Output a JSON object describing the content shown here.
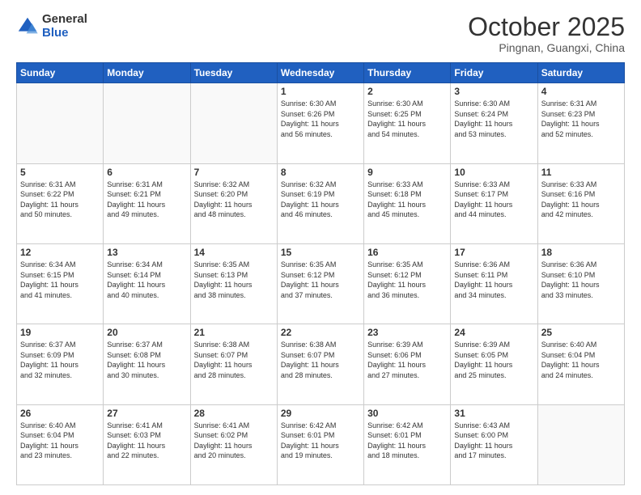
{
  "logo": {
    "general": "General",
    "blue": "Blue"
  },
  "header": {
    "month": "October 2025",
    "location": "Pingnan, Guangxi, China"
  },
  "weekdays": [
    "Sunday",
    "Monday",
    "Tuesday",
    "Wednesday",
    "Thursday",
    "Friday",
    "Saturday"
  ],
  "weeks": [
    [
      {
        "day": "",
        "info": ""
      },
      {
        "day": "",
        "info": ""
      },
      {
        "day": "",
        "info": ""
      },
      {
        "day": "1",
        "info": "Sunrise: 6:30 AM\nSunset: 6:26 PM\nDaylight: 11 hours\nand 56 minutes."
      },
      {
        "day": "2",
        "info": "Sunrise: 6:30 AM\nSunset: 6:25 PM\nDaylight: 11 hours\nand 54 minutes."
      },
      {
        "day": "3",
        "info": "Sunrise: 6:30 AM\nSunset: 6:24 PM\nDaylight: 11 hours\nand 53 minutes."
      },
      {
        "day": "4",
        "info": "Sunrise: 6:31 AM\nSunset: 6:23 PM\nDaylight: 11 hours\nand 52 minutes."
      }
    ],
    [
      {
        "day": "5",
        "info": "Sunrise: 6:31 AM\nSunset: 6:22 PM\nDaylight: 11 hours\nand 50 minutes."
      },
      {
        "day": "6",
        "info": "Sunrise: 6:31 AM\nSunset: 6:21 PM\nDaylight: 11 hours\nand 49 minutes."
      },
      {
        "day": "7",
        "info": "Sunrise: 6:32 AM\nSunset: 6:20 PM\nDaylight: 11 hours\nand 48 minutes."
      },
      {
        "day": "8",
        "info": "Sunrise: 6:32 AM\nSunset: 6:19 PM\nDaylight: 11 hours\nand 46 minutes."
      },
      {
        "day": "9",
        "info": "Sunrise: 6:33 AM\nSunset: 6:18 PM\nDaylight: 11 hours\nand 45 minutes."
      },
      {
        "day": "10",
        "info": "Sunrise: 6:33 AM\nSunset: 6:17 PM\nDaylight: 11 hours\nand 44 minutes."
      },
      {
        "day": "11",
        "info": "Sunrise: 6:33 AM\nSunset: 6:16 PM\nDaylight: 11 hours\nand 42 minutes."
      }
    ],
    [
      {
        "day": "12",
        "info": "Sunrise: 6:34 AM\nSunset: 6:15 PM\nDaylight: 11 hours\nand 41 minutes."
      },
      {
        "day": "13",
        "info": "Sunrise: 6:34 AM\nSunset: 6:14 PM\nDaylight: 11 hours\nand 40 minutes."
      },
      {
        "day": "14",
        "info": "Sunrise: 6:35 AM\nSunset: 6:13 PM\nDaylight: 11 hours\nand 38 minutes."
      },
      {
        "day": "15",
        "info": "Sunrise: 6:35 AM\nSunset: 6:12 PM\nDaylight: 11 hours\nand 37 minutes."
      },
      {
        "day": "16",
        "info": "Sunrise: 6:35 AM\nSunset: 6:12 PM\nDaylight: 11 hours\nand 36 minutes."
      },
      {
        "day": "17",
        "info": "Sunrise: 6:36 AM\nSunset: 6:11 PM\nDaylight: 11 hours\nand 34 minutes."
      },
      {
        "day": "18",
        "info": "Sunrise: 6:36 AM\nSunset: 6:10 PM\nDaylight: 11 hours\nand 33 minutes."
      }
    ],
    [
      {
        "day": "19",
        "info": "Sunrise: 6:37 AM\nSunset: 6:09 PM\nDaylight: 11 hours\nand 32 minutes."
      },
      {
        "day": "20",
        "info": "Sunrise: 6:37 AM\nSunset: 6:08 PM\nDaylight: 11 hours\nand 30 minutes."
      },
      {
        "day": "21",
        "info": "Sunrise: 6:38 AM\nSunset: 6:07 PM\nDaylight: 11 hours\nand 28 minutes."
      },
      {
        "day": "22",
        "info": "Sunrise: 6:38 AM\nSunset: 6:07 PM\nDaylight: 11 hours\nand 28 minutes."
      },
      {
        "day": "23",
        "info": "Sunrise: 6:39 AM\nSunset: 6:06 PM\nDaylight: 11 hours\nand 27 minutes."
      },
      {
        "day": "24",
        "info": "Sunrise: 6:39 AM\nSunset: 6:05 PM\nDaylight: 11 hours\nand 25 minutes."
      },
      {
        "day": "25",
        "info": "Sunrise: 6:40 AM\nSunset: 6:04 PM\nDaylight: 11 hours\nand 24 minutes."
      }
    ],
    [
      {
        "day": "26",
        "info": "Sunrise: 6:40 AM\nSunset: 6:04 PM\nDaylight: 11 hours\nand 23 minutes."
      },
      {
        "day": "27",
        "info": "Sunrise: 6:41 AM\nSunset: 6:03 PM\nDaylight: 11 hours\nand 22 minutes."
      },
      {
        "day": "28",
        "info": "Sunrise: 6:41 AM\nSunset: 6:02 PM\nDaylight: 11 hours\nand 20 minutes."
      },
      {
        "day": "29",
        "info": "Sunrise: 6:42 AM\nSunset: 6:01 PM\nDaylight: 11 hours\nand 19 minutes."
      },
      {
        "day": "30",
        "info": "Sunrise: 6:42 AM\nSunset: 6:01 PM\nDaylight: 11 hours\nand 18 minutes."
      },
      {
        "day": "31",
        "info": "Sunrise: 6:43 AM\nSunset: 6:00 PM\nDaylight: 11 hours\nand 17 minutes."
      },
      {
        "day": "",
        "info": ""
      }
    ]
  ]
}
